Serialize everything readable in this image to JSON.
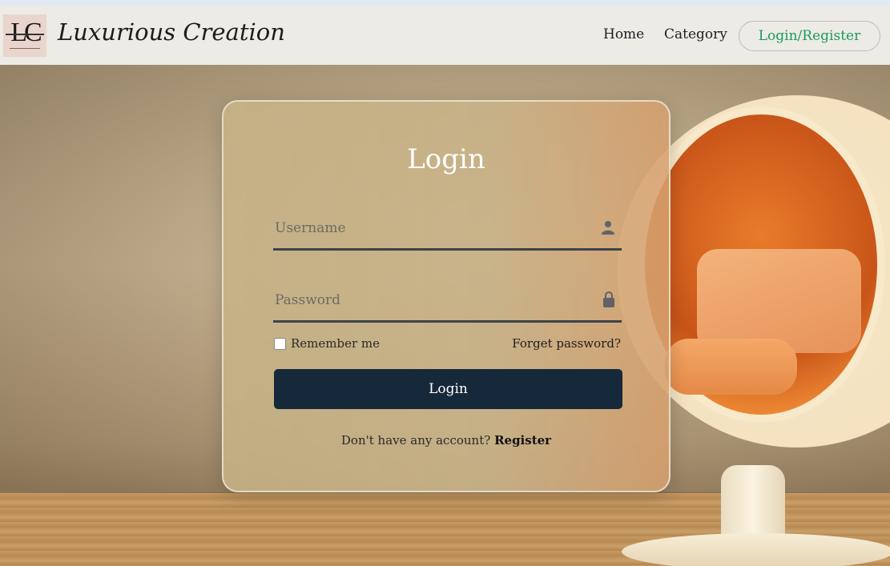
{
  "navbar": {
    "logo_text": "LC",
    "brand_name": "Luxurious Creation",
    "links": [
      {
        "label": "Home"
      },
      {
        "label": "Category"
      }
    ],
    "auth_button": "Login/Register"
  },
  "login": {
    "title": "Login",
    "username_placeholder": "Username",
    "password_placeholder": "Password",
    "remember_label": "Remember me",
    "forgot_label": "Forget password?",
    "submit_label": "Login",
    "register_prompt": "Don't have any account?",
    "register_link": "Register"
  },
  "icons": {
    "user": "user-icon",
    "lock": "lock-icon"
  },
  "colors": {
    "accent_green": "#1d9a5b",
    "button_navy": "#16293a"
  }
}
